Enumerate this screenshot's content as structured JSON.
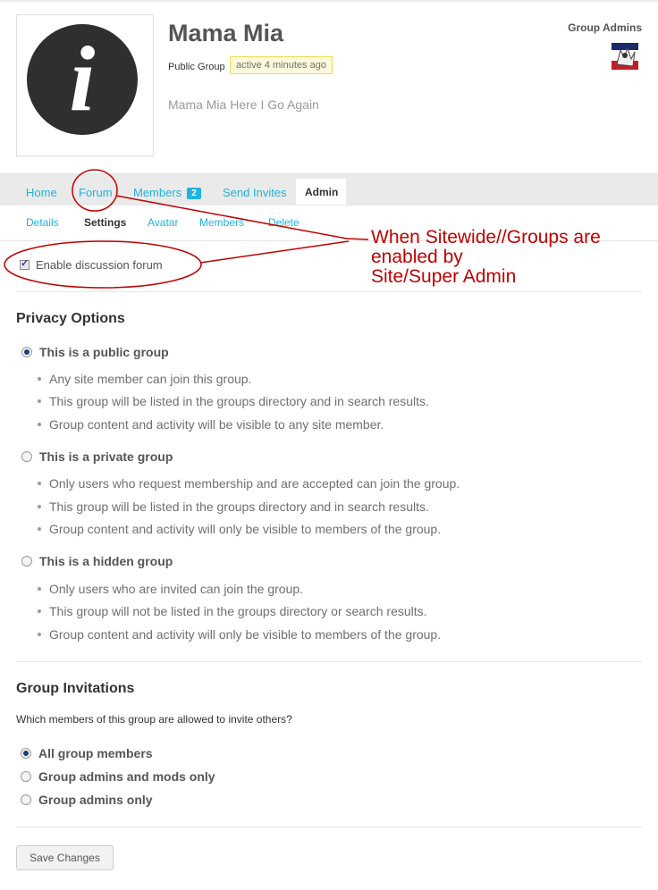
{
  "group": {
    "name": "Mama Mia",
    "type": "Public Group",
    "activity": "active 4 minutes ago",
    "description": "Mama Mia Here I Go Again",
    "admins_label": "Group Admins"
  },
  "nav": {
    "home": "Home",
    "forum": "Forum",
    "members": "Members",
    "members_count": "2",
    "send_invites": "Send Invites",
    "admin": "Admin"
  },
  "subnav": {
    "details": "Details",
    "settings": "Settings",
    "avatar": "Avatar",
    "members": "Members",
    "delete": "Delete"
  },
  "forum": {
    "label": "Enable discussion forum",
    "checked": true
  },
  "privacy": {
    "title": "Privacy Options",
    "options": [
      {
        "label": "This is a public group",
        "selected": true,
        "bullets": [
          "Any site member can join this group.",
          "This group will be listed in the groups directory and in search results.",
          "Group content and activity will be visible to any site member."
        ]
      },
      {
        "label": "This is a private group",
        "selected": false,
        "bullets": [
          "Only users who request membership and are accepted can join the group.",
          "This group will be listed in the groups directory and in search results.",
          "Group content and activity will only be visible to members of the group."
        ]
      },
      {
        "label": "This is a hidden group",
        "selected": false,
        "bullets": [
          "Only users who are invited can join the group.",
          "This group will not be listed in the groups directory or search results.",
          "Group content and activity will only be visible to members of the group."
        ]
      }
    ]
  },
  "invitations": {
    "title": "Group Invitations",
    "question": "Which members of this group are allowed to invite others?",
    "options": [
      {
        "label": "All group members",
        "selected": true
      },
      {
        "label": "Group admins and mods only",
        "selected": false
      },
      {
        "label": "Group admins only",
        "selected": false
      }
    ]
  },
  "save_label": "Save Changes",
  "annotation": {
    "line1": "When Sitewide//Groups are",
    "line2": "enabled by",
    "line3": "Site/Super Admin",
    "color": "#c00000"
  },
  "icons": {
    "group_avatar": "info-icon",
    "admin_avatar": "user-avatar-icon"
  }
}
